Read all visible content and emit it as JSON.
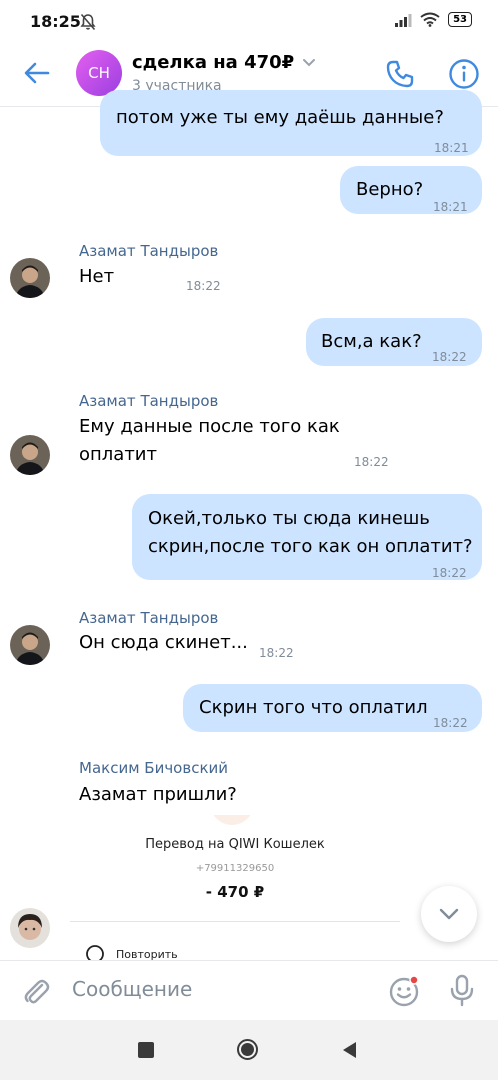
{
  "status": {
    "time": "18:25",
    "battery": "53"
  },
  "header": {
    "avatar_initials": "СН",
    "title": "сделка на 470₽",
    "subtitle": "3 участника"
  },
  "messages": {
    "m1": {
      "text": "потом уже ты ему даёшь данные?",
      "time": "18:21"
    },
    "m2": {
      "text": "Верно?",
      "time": "18:21"
    },
    "m3": {
      "sender": "Азамат Тандыров",
      "text": "Нет",
      "time": "18:22"
    },
    "m4": {
      "text": "Всм,а как?",
      "time": "18:22"
    },
    "m5": {
      "sender": "Азамат Тандыров",
      "line1": "Ему данные после того как",
      "line2": "оплатит",
      "time": "18:22"
    },
    "m6": {
      "line1": "Окей,только ты сюда кинешь",
      "line2": "скрин,после того как он оплатит?",
      "time": "18:22"
    },
    "m7": {
      "sender": "Азамат Тандыров",
      "text": "Он сюда скинет...",
      "time": "18:22"
    },
    "m8": {
      "text": "Скрин того что оплатил",
      "time": "18:22"
    },
    "m9": {
      "sender": "Максим Бичовский",
      "text": "Азамат пришли?",
      "receipt_title": "Перевод на QIWI Кошелек",
      "receipt_phone": "+79911329650",
      "receipt_amount": "- 470 ₽",
      "receipt_action": "Повторить"
    }
  },
  "composer": {
    "placeholder": "Сообщение"
  },
  "colors": {
    "accent": "#3f8ae0",
    "outgoing_bubble": "#cce4ff",
    "sender_name": "#45678f",
    "secondary_text": "#818c99"
  },
  "icons": {
    "back": "arrow-left-icon",
    "call": "phone-icon",
    "info": "info-icon",
    "attach": "paperclip-icon",
    "sticker": "smile-icon",
    "voice": "microphone-icon",
    "scroll": "chevron-down-icon"
  }
}
